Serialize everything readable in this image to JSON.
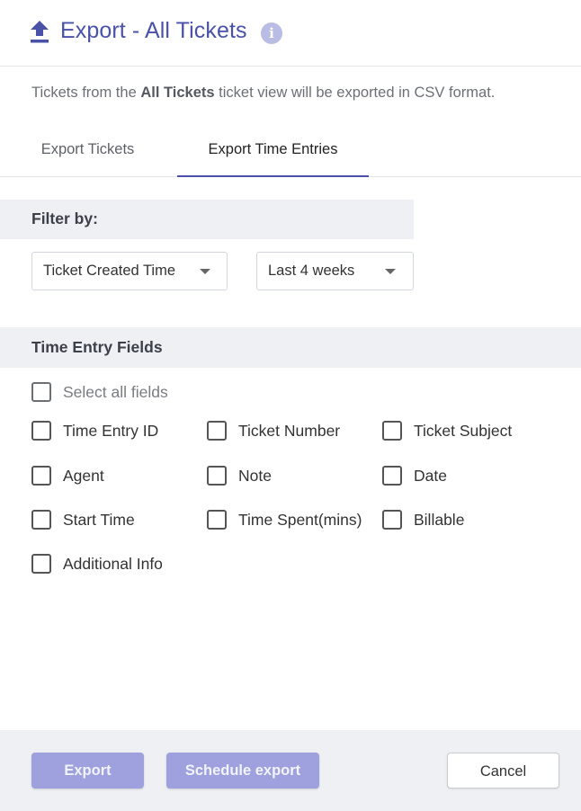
{
  "header": {
    "title": "Export - All Tickets",
    "info_glyph": "i",
    "upload_icon": "upload-icon",
    "accent_color": "#4a52a8"
  },
  "description": {
    "prefix": "Tickets from the ",
    "view_name": "All Tickets",
    "suffix": " ticket view will be exported in CSV format."
  },
  "tabs": [
    {
      "label": "Export Tickets",
      "active": false
    },
    {
      "label": "Export Time Entries",
      "active": true
    }
  ],
  "filter": {
    "label": "Filter by:",
    "field_select": "Ticket Created Time",
    "range_select": "Last 4 weeks"
  },
  "fields": {
    "label": "Time Entry Fields",
    "select_all": {
      "label": "Select all fields",
      "checked": false
    },
    "items": [
      {
        "label": "Time Entry ID",
        "checked": false
      },
      {
        "label": "Ticket Number",
        "checked": false
      },
      {
        "label": "Ticket Subject",
        "checked": false
      },
      {
        "label": "Agent",
        "checked": false
      },
      {
        "label": "Note",
        "checked": false
      },
      {
        "label": "Date",
        "checked": false
      },
      {
        "label": "Start Time",
        "checked": false
      },
      {
        "label": "Time Spent(mins)",
        "checked": false
      },
      {
        "label": "Billable",
        "checked": false
      },
      {
        "label": "Additional Info",
        "checked": false
      }
    ]
  },
  "footer": {
    "export_label": "Export",
    "schedule_label": "Schedule export",
    "cancel_label": "Cancel"
  }
}
